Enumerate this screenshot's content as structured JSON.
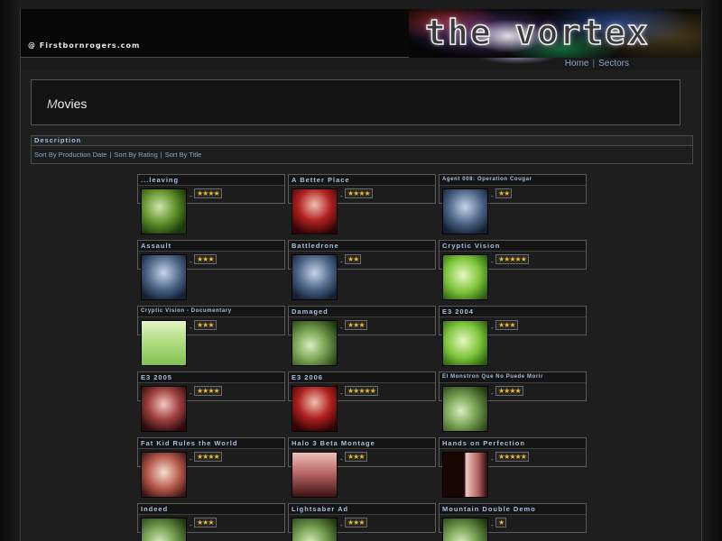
{
  "header": {
    "site_credit": "@ Firstbornrogers.com",
    "logo_text": "the vortex"
  },
  "nav": {
    "home": "Home",
    "separator": "|",
    "sectors": "Sectors"
  },
  "page": {
    "title_first": "M",
    "title_rest": "ovies"
  },
  "description": {
    "header": "Description",
    "sort_production": "Sort By Production Date",
    "sort_rating": "Sort By Rating",
    "sort_title": "Sort By Title",
    "separator": "|"
  },
  "movies": [
    {
      "title": "...leaving",
      "rating": "★★★★",
      "stars": 4
    },
    {
      "title": "A Better Place",
      "rating": "★★★★",
      "stars": 4
    },
    {
      "title": "Agent 008: Operation Cougar",
      "rating": "★★",
      "stars": 2
    },
    {
      "title": "Assault",
      "rating": "★★★",
      "stars": 3
    },
    {
      "title": "Battledrone",
      "rating": "★★",
      "stars": 2
    },
    {
      "title": "Cryptic Vision",
      "rating": "★★★★★",
      "stars": 5
    },
    {
      "title": "Cryptic Vision - Documentary",
      "rating": "★★★",
      "stars": 3
    },
    {
      "title": "Damaged",
      "rating": "★★★",
      "stars": 3
    },
    {
      "title": "E3 2004",
      "rating": "★★★",
      "stars": 3
    },
    {
      "title": "E3 2005",
      "rating": "★★★★",
      "stars": 4
    },
    {
      "title": "E3 2006",
      "rating": "★★★★★",
      "stars": 5
    },
    {
      "title": "El Monstron Que No Puede Morir",
      "rating": "★★★★",
      "stars": 4
    },
    {
      "title": "Fat Kid Rules the World",
      "rating": "★★★★",
      "stars": 4
    },
    {
      "title": "Halo 3 Beta Montage",
      "rating": "★★★",
      "stars": 3
    },
    {
      "title": "Hands on Perfection",
      "rating": "★★★★★",
      "stars": 5
    },
    {
      "title": "Indeed",
      "rating": "★★★",
      "stars": 3
    },
    {
      "title": "Lightsaber Ad",
      "rating": "★★★",
      "stars": 3
    },
    {
      "title": "Mountain Double Demo",
      "rating": "★",
      "stars": 1
    }
  ],
  "colors": {
    "link": "#8aa6c8",
    "title_text": "#a8c0e0",
    "star": "#e8b830",
    "background": "#1e1e1e"
  }
}
